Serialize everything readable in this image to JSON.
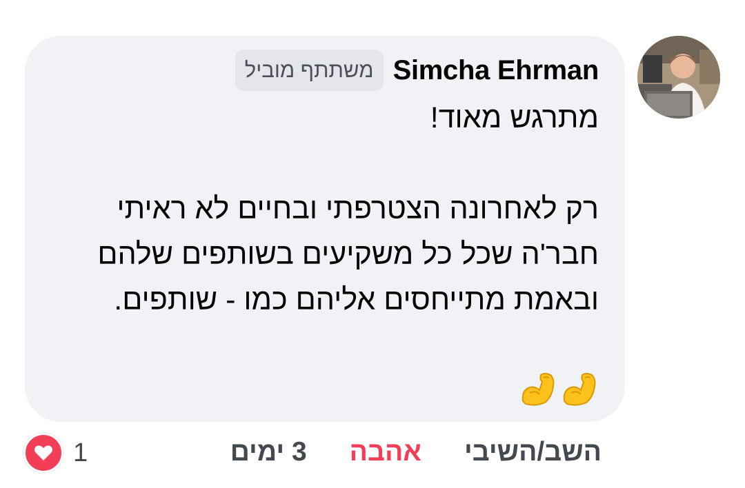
{
  "comment": {
    "author_name": "Simcha Ehrman",
    "badge_label": "משתתף מוביל",
    "text": "מתרגש מאוד!\n\nרק לאחרונה הצטרפתי ובחיים לא ראיתי חבר'ה שכל כל משקיעים בשותפים שלהם\nובאמת מתייחסים אליהם כמו - שותפים.",
    "emojis": [
      "flexed-biceps-icon",
      "flexed-biceps-icon"
    ]
  },
  "actions": {
    "timestamp": "3 ימים",
    "love_label": "אהבה",
    "reply_label": "השב/השיבי"
  },
  "reactions": {
    "icon": "heart-icon",
    "count": "1"
  },
  "colors": {
    "bubble": "#f0f2f5",
    "love": "#f33e58",
    "secondary_text": "#444950",
    "badge_bg": "#e4e6eb"
  }
}
